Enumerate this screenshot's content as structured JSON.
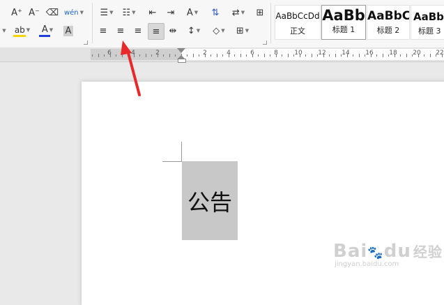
{
  "toolbar": {
    "row1": [
      {
        "name": "increase-font-size-button",
        "icon": "A⁺",
        "caret": false
      },
      {
        "name": "decrease-font-size-button",
        "icon": "A⁻",
        "caret": false
      },
      {
        "name": "clear-format-button",
        "icon": "⌫",
        "caret": false
      },
      {
        "name": "phonetic-guide-button",
        "icon": "wén",
        "caret": true
      },
      {
        "name": "bullet-list-button",
        "icon": "☰",
        "caret": true
      },
      {
        "name": "numbered-list-button",
        "icon": "☷",
        "caret": true
      },
      {
        "name": "decrease-indent-button",
        "icon": "⇤",
        "caret": false
      },
      {
        "name": "increase-indent-button",
        "icon": "⇥",
        "caret": false
      },
      {
        "name": "text-direction-button",
        "icon": "A",
        "caret": true
      },
      {
        "name": "sort-button",
        "icon": "⇅",
        "caret": false
      },
      {
        "name": "line-paragraph-button",
        "icon": "⇄",
        "caret": true
      },
      {
        "name": "table-insert-button",
        "icon": "⊞",
        "caret": false
      }
    ],
    "row2": [
      {
        "name": "highlight-color-button",
        "icon": "ab",
        "caret": true
      },
      {
        "name": "font-color-button",
        "icon": "A",
        "caret": true
      },
      {
        "name": "character-shading-button",
        "icon": "A",
        "caret": false
      },
      {
        "name": "align-left-button",
        "icon": "≡",
        "caret": false
      },
      {
        "name": "align-center-button",
        "icon": "≡",
        "caret": false
      },
      {
        "name": "align-right-button",
        "icon": "≡",
        "caret": false
      },
      {
        "name": "align-justify-button",
        "icon": "≡",
        "caret": false
      },
      {
        "name": "distributed-align-button",
        "icon": "⇹",
        "caret": false
      },
      {
        "name": "line-spacing-button",
        "icon": "↕",
        "caret": true
      },
      {
        "name": "shading-fill-button",
        "icon": "◇",
        "caret": true
      },
      {
        "name": "borders-button",
        "icon": "⊞",
        "caret": true
      }
    ],
    "highlight_color": "#f2d600",
    "font_color": "#1f3fd6"
  },
  "styles": [
    {
      "preview": "AaBbCcDd",
      "label": "正文"
    },
    {
      "preview": "AaBb",
      "label": "标题 1"
    },
    {
      "preview": "AaBbC",
      "label": "标题 2"
    },
    {
      "preview": "AaBb",
      "label": "标题 3"
    }
  ],
  "ruler": {
    "numbers": [
      "6",
      "4",
      "2",
      "2",
      "4",
      "6",
      "8",
      "10",
      "12",
      "14",
      "16",
      "18",
      "20",
      "22"
    ]
  },
  "document": {
    "text": "公告"
  },
  "annotation": {
    "color": "#e8282a"
  },
  "watermark": {
    "main": "Bai",
    "paw": "du",
    "cn": "经验",
    "sub": "jingyan.baidu.com"
  }
}
